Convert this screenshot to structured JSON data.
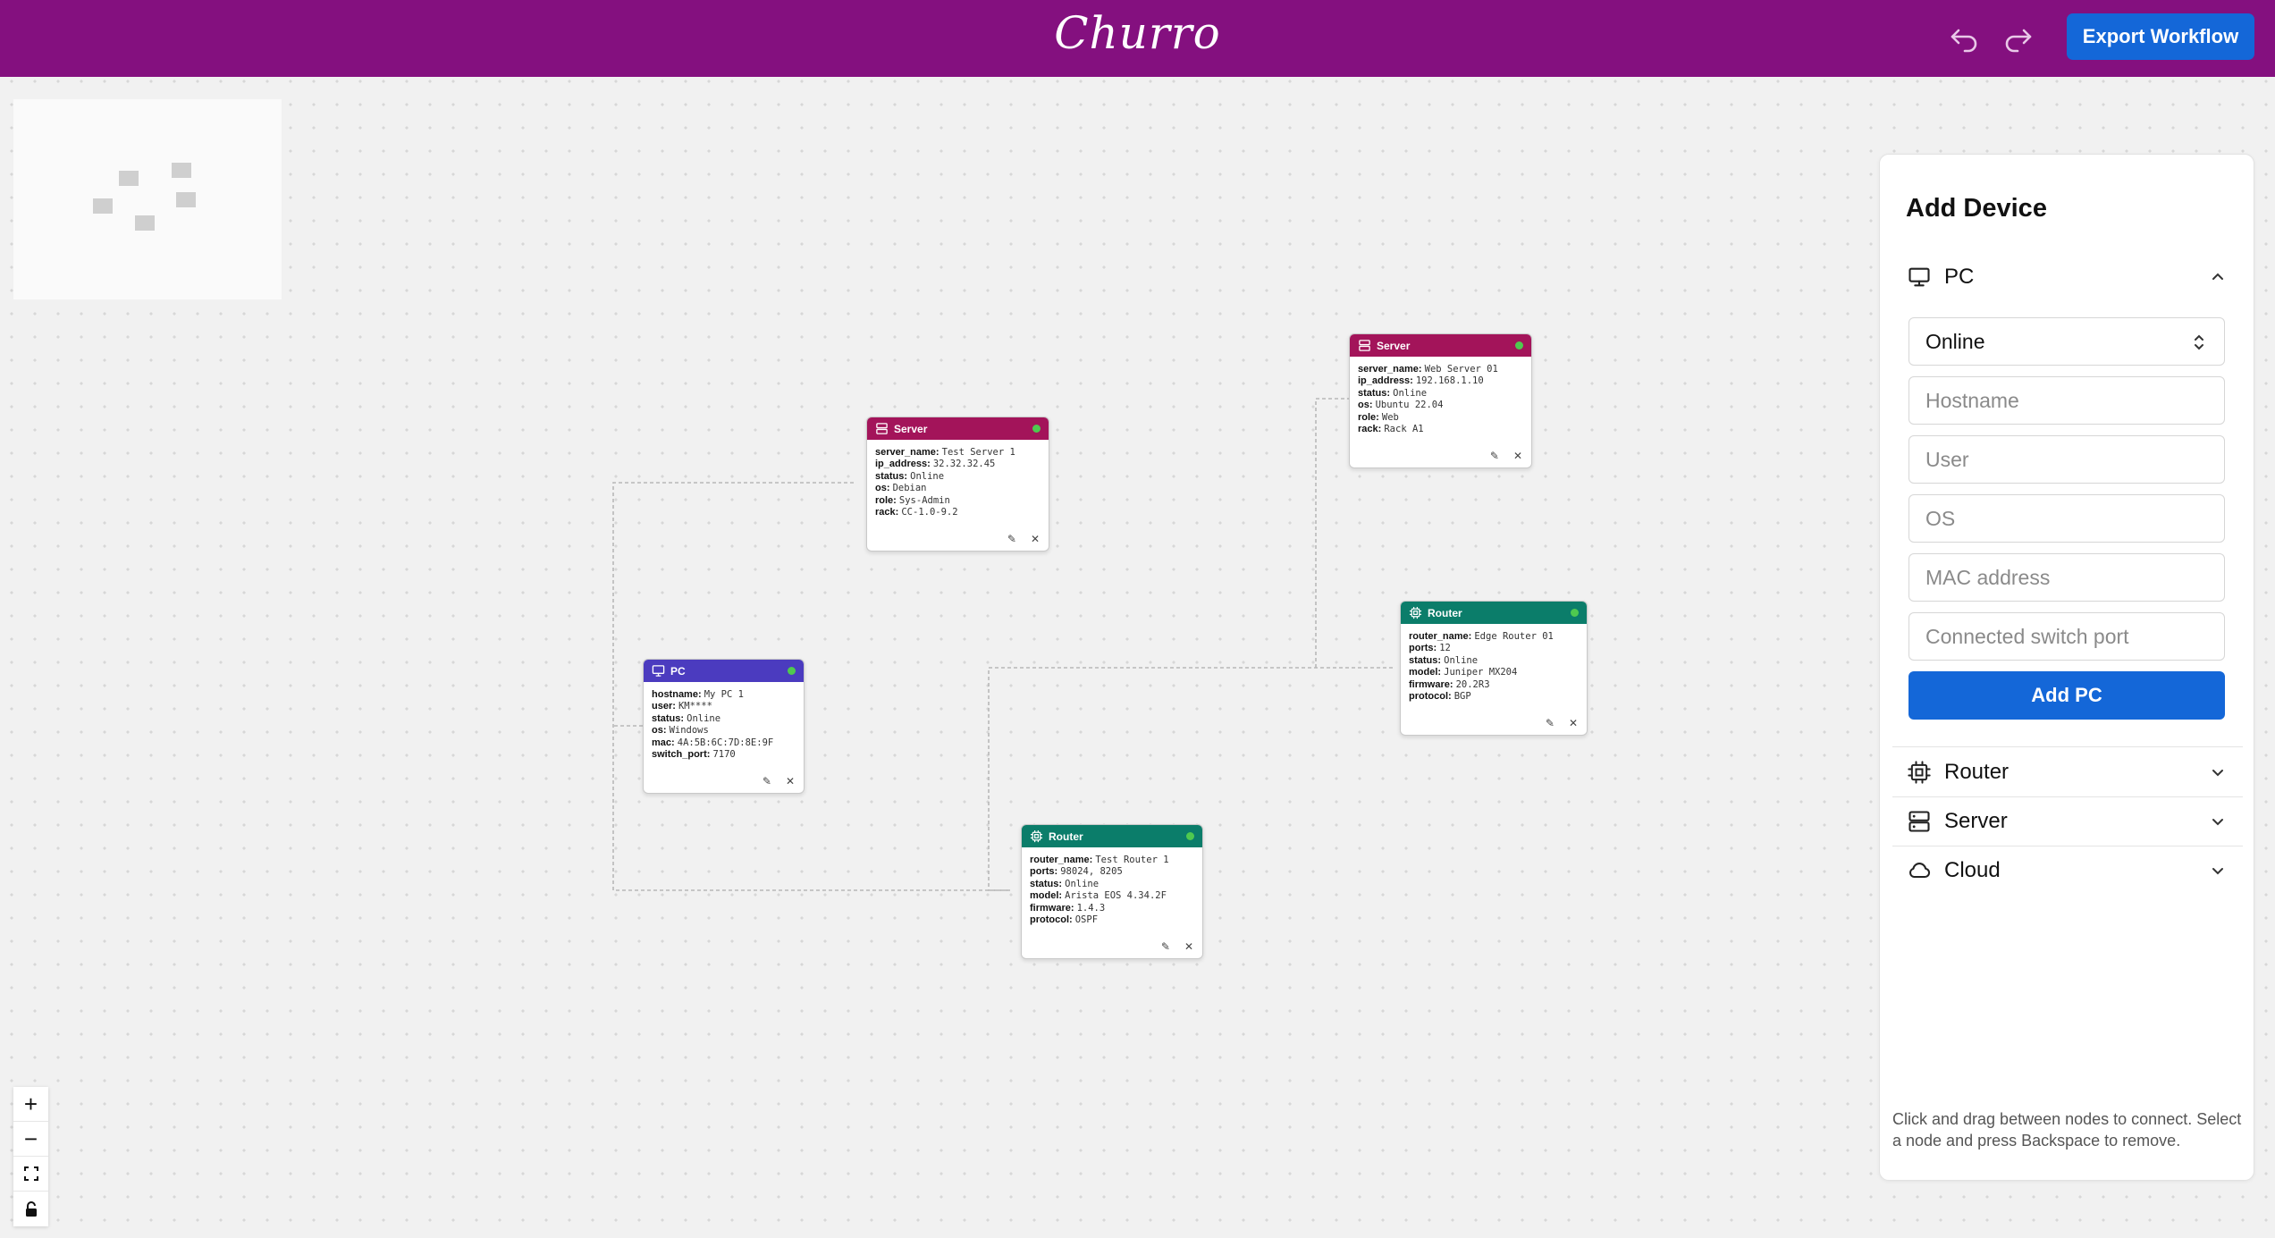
{
  "header": {
    "brand": "Churro",
    "undo_icon": "undo-icon",
    "redo_icon": "redo-icon",
    "export_label": "Export Workflow",
    "bg_color": "#84107f",
    "button_color": "#1467d8"
  },
  "nodes": {
    "server1": {
      "type_label": "Server",
      "color": "#a3145a",
      "fields": [
        {
          "key": "server_name:",
          "val": "Test Server 1"
        },
        {
          "key": "ip_address:",
          "val": "32.32.32.45"
        },
        {
          "key": "status:",
          "val": "Online"
        },
        {
          "key": "os:",
          "val": "Debian"
        },
        {
          "key": "role:",
          "val": "Sys-Admin"
        },
        {
          "key": "rack:",
          "val": "CC-1.0-9.2"
        }
      ]
    },
    "server2": {
      "type_label": "Server",
      "color": "#a3145a",
      "fields": [
        {
          "key": "server_name:",
          "val": "Web Server 01"
        },
        {
          "key": "ip_address:",
          "val": "192.168.1.10"
        },
        {
          "key": "status:",
          "val": "Online"
        },
        {
          "key": "os:",
          "val": "Ubuntu 22.04"
        },
        {
          "key": "role:",
          "val": "Web"
        },
        {
          "key": "rack:",
          "val": "Rack A1"
        }
      ]
    },
    "pc1": {
      "type_label": "PC",
      "color": "#4b3bbf",
      "fields": [
        {
          "key": "hostname:",
          "val": "My PC 1"
        },
        {
          "key": "user:",
          "val": "KM****"
        },
        {
          "key": "status:",
          "val": "Online"
        },
        {
          "key": "os:",
          "val": "Windows"
        },
        {
          "key": "mac:",
          "val": "4A:5B:6C:7D:8E:9F"
        },
        {
          "key": "switch_port:",
          "val": "7170"
        }
      ]
    },
    "router1": {
      "type_label": "Router",
      "color": "#0b7d6a",
      "fields": [
        {
          "key": "router_name:",
          "val": "Edge Router 01"
        },
        {
          "key": "ports:",
          "val": "12"
        },
        {
          "key": "status:",
          "val": "Online"
        },
        {
          "key": "model:",
          "val": "Juniper MX204"
        },
        {
          "key": "firmware:",
          "val": "20.2R3"
        },
        {
          "key": "protocol:",
          "val": "BGP"
        }
      ]
    },
    "router2": {
      "type_label": "Router",
      "color": "#0b7d6a",
      "fields": [
        {
          "key": "router_name:",
          "val": "Test Router 1"
        },
        {
          "key": "ports:",
          "val": "98024, 8205"
        },
        {
          "key": "status:",
          "val": "Online"
        },
        {
          "key": "model:",
          "val": "Arista EOS 4.34.2F"
        },
        {
          "key": "firmware:",
          "val": "1.4.3"
        },
        {
          "key": "protocol:",
          "val": "OSPF"
        }
      ]
    }
  },
  "panel": {
    "title": "Add Device",
    "pc_section": {
      "label": "PC",
      "status_value": "Online",
      "placeholders": {
        "hostname": "Hostname",
        "user": "User",
        "os": "OS",
        "mac": "MAC address",
        "switch_port": "Connected switch port"
      },
      "add_label": "Add PC"
    },
    "sections": {
      "router": "Router",
      "server": "Server",
      "cloud": "Cloud"
    },
    "hint": "Click and drag between nodes to connect. Select a node and press Backspace to remove."
  },
  "controls": {
    "zoom_in": "+",
    "zoom_out": "−"
  }
}
